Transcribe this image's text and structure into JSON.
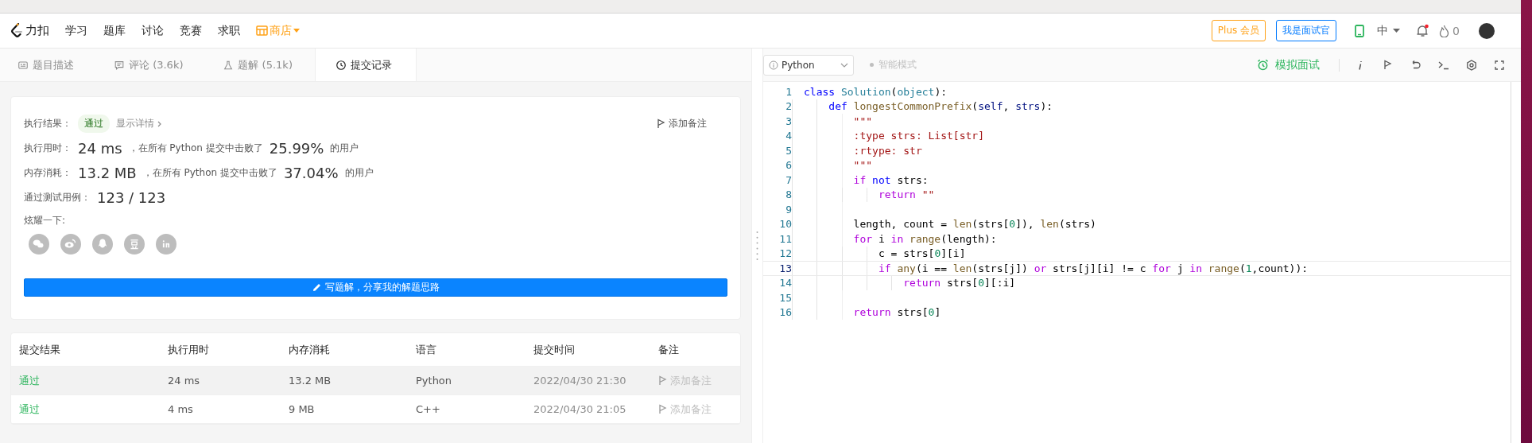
{
  "nav": {
    "logo_text": "力扣",
    "items": [
      {
        "label": "学习"
      },
      {
        "label": "题库"
      },
      {
        "label": "讨论"
      },
      {
        "label": "竞赛"
      },
      {
        "label": "求职"
      }
    ],
    "store": {
      "label": "商店"
    },
    "plus_button": "Plus 会员",
    "interviewer_button": "我是面试官",
    "language": "中",
    "notification_unread": true,
    "streak": "0"
  },
  "tabs": [
    {
      "label": "题目描述",
      "selected": false
    },
    {
      "label": "评论 (3.6k)",
      "selected": false
    },
    {
      "label": "题解 (5.1k)",
      "selected": false
    },
    {
      "label": "提交记录",
      "selected": true
    }
  ],
  "result": {
    "label": "执行结果：",
    "status": "通过",
    "details_link": "显示详情",
    "add_note": "添加备注",
    "stats": [
      {
        "label": "执行用时：",
        "value": "24 ms",
        "text": "，在所有 Python 提交中击败了",
        "percent": "25.99%",
        "suffix": "的用户"
      },
      {
        "label": "内存消耗：",
        "value": "13.2 MB",
        "text": "，在所有 Python 提交中击败了",
        "percent": "37.04%",
        "suffix": "的用户"
      }
    ],
    "tests": {
      "label": "通过测试用例：",
      "value": "123 / 123"
    },
    "share": {
      "label": "炫耀一下:",
      "icons": [
        {
          "kind": "wechat"
        },
        {
          "kind": "weibo"
        },
        {
          "kind": "qq"
        },
        {
          "kind": "douban"
        },
        {
          "kind": "linkedin"
        }
      ]
    },
    "write_button": "写题解，分享我的解题思路"
  },
  "submissions": {
    "columns": [
      "提交结果",
      "执行用时",
      "内存消耗",
      "语言",
      "提交时间",
      "备注"
    ],
    "rows": [
      {
        "status": "通过",
        "kind": "accepted",
        "runtime": "24 ms",
        "memory": "13.2 MB",
        "language": "Python",
        "time": "2022/04/30 21:30",
        "note": "添加备注",
        "highlighted": true
      },
      {
        "status": "通过",
        "kind": "accepted",
        "runtime": "4 ms",
        "memory": "9 MB",
        "language": "C++",
        "time": "2022/04/30 21:05",
        "note": "添加备注",
        "highlighted": false
      }
    ]
  },
  "editor": {
    "language": "Python",
    "smart_mode": "智能模式",
    "mock_interview": "模拟面试",
    "lines": [
      {
        "number": "1",
        "current": false,
        "tokens": [
          {
            "text": "class ",
            "kind": "kw"
          },
          {
            "text": "Solution",
            "kind": "cls"
          },
          {
            "text": "(",
            "kind": "p"
          },
          {
            "text": "object",
            "kind": "cls"
          },
          {
            "text": "):",
            "kind": "p"
          }
        ]
      },
      {
        "number": "2",
        "current": false,
        "tokens": [
          {
            "text": "    def ",
            "kind": "kw"
          },
          {
            "text": "longestCommonPrefix",
            "kind": "fn"
          },
          {
            "text": "(",
            "kind": "p"
          },
          {
            "text": "self",
            "kind": "self"
          },
          {
            "text": ", ",
            "kind": "p"
          },
          {
            "text": "strs",
            "kind": "self"
          },
          {
            "text": "):",
            "kind": "p"
          }
        ]
      },
      {
        "number": "3",
        "current": false,
        "tokens": [
          {
            "text": "        \"\"\"",
            "kind": "str"
          }
        ]
      },
      {
        "number": "4",
        "current": false,
        "tokens": [
          {
            "text": "        :type strs: List[str]",
            "kind": "str"
          }
        ]
      },
      {
        "number": "5",
        "current": false,
        "tokens": [
          {
            "text": "        :rtype: str",
            "kind": "str"
          }
        ]
      },
      {
        "number": "6",
        "current": false,
        "tokens": [
          {
            "text": "        \"\"\"",
            "kind": "str"
          }
        ]
      },
      {
        "number": "7",
        "current": false,
        "tokens": [
          {
            "text": "        if ",
            "kind": "ctl"
          },
          {
            "text": "not ",
            "kind": "kw"
          },
          {
            "text": "strs:",
            "kind": "p"
          }
        ]
      },
      {
        "number": "8",
        "current": false,
        "tokens": [
          {
            "text": "            return ",
            "kind": "ctl"
          },
          {
            "text": "\"\"",
            "kind": "str"
          }
        ]
      },
      {
        "number": "9",
        "current": false
      },
      {
        "number": "10",
        "current": false,
        "tokens": [
          {
            "text": "        length, count = ",
            "kind": "p"
          },
          {
            "text": "len",
            "kind": "fn"
          },
          {
            "text": "(strs[",
            "kind": "p"
          },
          {
            "text": "0",
            "kind": "num"
          },
          {
            "text": "]), ",
            "kind": "p"
          },
          {
            "text": "len",
            "kind": "fn"
          },
          {
            "text": "(strs)",
            "kind": "p"
          }
        ]
      },
      {
        "number": "11",
        "current": false,
        "tokens": [
          {
            "text": "        for ",
            "kind": "ctl"
          },
          {
            "text": "i ",
            "kind": "p"
          },
          {
            "text": "in ",
            "kind": "ctl"
          },
          {
            "text": "range",
            "kind": "fn"
          },
          {
            "text": "(length):",
            "kind": "p"
          }
        ]
      },
      {
        "number": "12",
        "current": false,
        "tokens": [
          {
            "text": "            c = strs[",
            "kind": "p"
          },
          {
            "text": "0",
            "kind": "num"
          },
          {
            "text": "][i]",
            "kind": "p"
          }
        ]
      },
      {
        "number": "13",
        "current": true,
        "tokens": [
          {
            "text": "            if ",
            "kind": "ctl"
          },
          {
            "text": "any",
            "kind": "fn"
          },
          {
            "text": "(i == ",
            "kind": "p"
          },
          {
            "text": "len",
            "kind": "fn"
          },
          {
            "text": "(strs[j]) ",
            "kind": "p"
          },
          {
            "text": "or ",
            "kind": "ctl"
          },
          {
            "text": "strs[j][i] != c ",
            "kind": "p"
          },
          {
            "text": "for ",
            "kind": "ctl"
          },
          {
            "text": "j ",
            "kind": "p"
          },
          {
            "text": "in ",
            "kind": "ctl"
          },
          {
            "text": "range",
            "kind": "fn"
          },
          {
            "text": "(",
            "kind": "p"
          },
          {
            "text": "1",
            "kind": "num"
          },
          {
            "text": ",count)):",
            "kind": "p"
          }
        ]
      },
      {
        "number": "14",
        "current": false,
        "tokens": [
          {
            "text": "                return ",
            "kind": "ctl"
          },
          {
            "text": "strs[",
            "kind": "p"
          },
          {
            "text": "0",
            "kind": "num"
          },
          {
            "text": "][:i]",
            "kind": "p"
          }
        ]
      },
      {
        "number": "15",
        "current": false
      },
      {
        "number": "16",
        "current": false,
        "tokens": [
          {
            "text": "        return ",
            "kind": "ctl"
          },
          {
            "text": "strs[",
            "kind": "p"
          },
          {
            "text": "0",
            "kind": "num"
          },
          {
            "text": "]",
            "kind": "p"
          }
        ]
      }
    ]
  }
}
